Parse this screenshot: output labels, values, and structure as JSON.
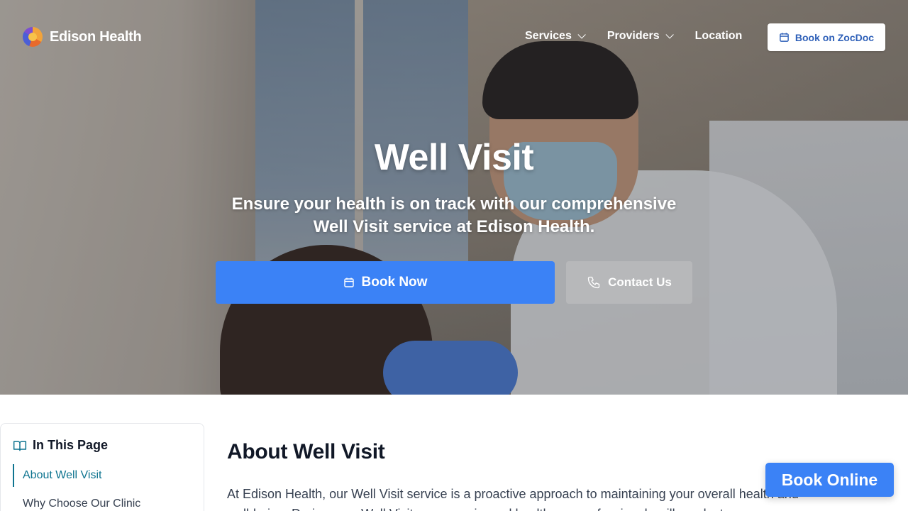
{
  "brand": {
    "name": "Edison Health"
  },
  "nav": {
    "items": [
      {
        "label": "Services",
        "has_dropdown": true
      },
      {
        "label": "Providers",
        "has_dropdown": true
      },
      {
        "label": "Location",
        "has_dropdown": false
      }
    ],
    "cta_label": "Book on ZocDoc",
    "cta_icon": "calendar-icon"
  },
  "hero": {
    "title": "Well Visit",
    "subtitle": "Ensure your health is on track with our comprehensive Well Visit service at Edison Health.",
    "primary_button": "Book Now",
    "secondary_button": "Contact Us"
  },
  "toc": {
    "heading": "In This Page",
    "items": [
      {
        "label": "About Well Visit",
        "active": true
      },
      {
        "label": "Why Choose Our Clinic",
        "active": false
      }
    ]
  },
  "main": {
    "heading": "About Well Visit",
    "paragraph": "At Edison Health, our Well Visit service is a proactive approach to maintaining your overall health and well-being. During your Well Visit, our experienced healthcare professionals will conduct a"
  },
  "floating": {
    "book_online": "Book Online"
  },
  "colors": {
    "primary_blue": "#3b82f6",
    "accent_teal": "#0e7490",
    "cta_text": "#2d5fb8"
  }
}
